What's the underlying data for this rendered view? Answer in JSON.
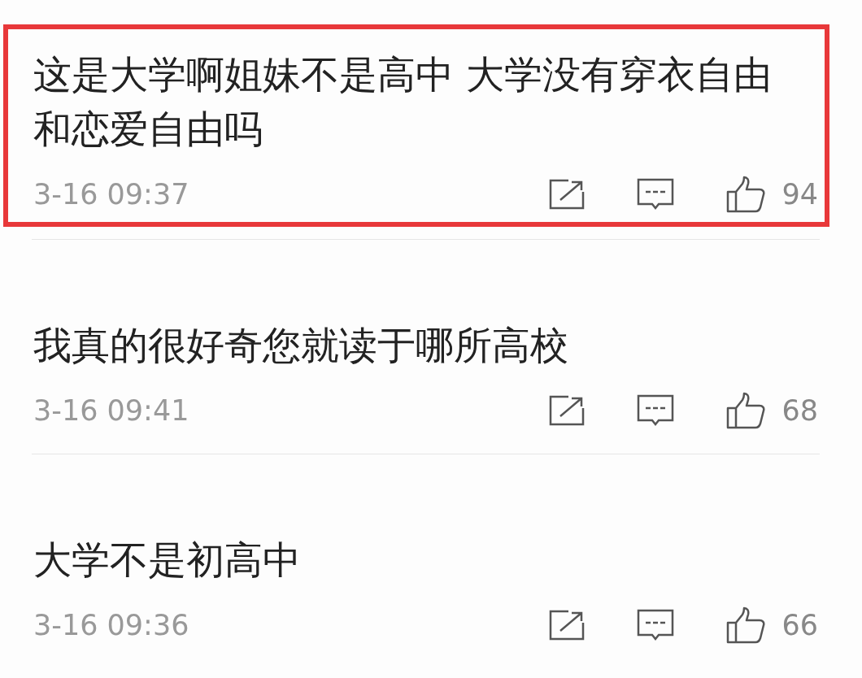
{
  "comments": [
    {
      "text": "这是大学啊姐妹不是高中 大学没有穿衣自由和恋爱自由吗",
      "time": "3-16 09:37",
      "likes": "94",
      "highlighted": true
    },
    {
      "text": "我真的很好奇您就读于哪所高校",
      "time": "3-16 09:41",
      "likes": "68",
      "highlighted": false
    },
    {
      "text": "大学不是初高中",
      "time": "3-16 09:36",
      "likes": "66",
      "highlighted": false
    }
  ]
}
